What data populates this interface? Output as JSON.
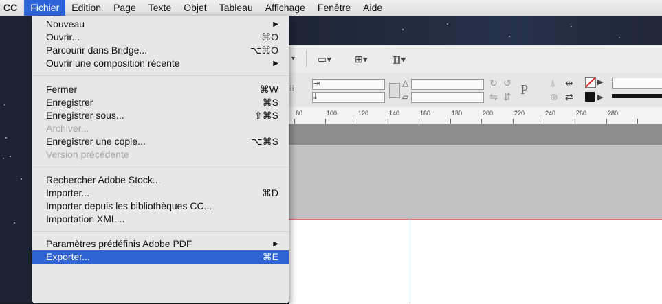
{
  "menubar": {
    "items": [
      "CC",
      "Fichier",
      "Edition",
      "Page",
      "Texte",
      "Objet",
      "Tableau",
      "Affichage",
      "Fenêtre",
      "Aide"
    ]
  },
  "menu": {
    "items": [
      {
        "label": "Nouveau",
        "shortcut": "▶"
      },
      {
        "label": "Ouvrir...",
        "shortcut": "⌘O"
      },
      {
        "label": "Parcourir dans Bridge...",
        "shortcut": "⌥⌘O"
      },
      {
        "label": "Ouvrir une composition récente",
        "shortcut": "▶"
      },
      {
        "label": "Fermer",
        "shortcut": "⌘W"
      },
      {
        "label": "Enregistrer",
        "shortcut": "⌘S"
      },
      {
        "label": "Enregistrer sous...",
        "shortcut": "⇧⌘S"
      },
      {
        "label": "Archiver...",
        "shortcut": ""
      },
      {
        "label": "Enregistrer une copie...",
        "shortcut": "⌥⌘S"
      },
      {
        "label": "Version précédente",
        "shortcut": ""
      },
      {
        "label": "Rechercher Adobe Stock...",
        "shortcut": ""
      },
      {
        "label": "Importer...",
        "shortcut": "⌘D"
      },
      {
        "label": "Importer depuis les bibliothèques CC...",
        "shortcut": ""
      },
      {
        "label": "Importation XML...",
        "shortcut": ""
      },
      {
        "label": "Paramètres prédéfinis Adobe PDF",
        "shortcut": "▶"
      },
      {
        "label": "Exporter...",
        "shortcut": "⌘E"
      }
    ]
  },
  "ruler": {
    "ticks": [
      "80",
      "100",
      "120",
      "140",
      "160",
      "180",
      "200",
      "220",
      "240",
      "260",
      "280"
    ]
  },
  "toolbar": {
    "type_icon": "P"
  },
  "colors": {
    "selection": "#2f62d3",
    "menubar_active": "#2c63d8"
  }
}
